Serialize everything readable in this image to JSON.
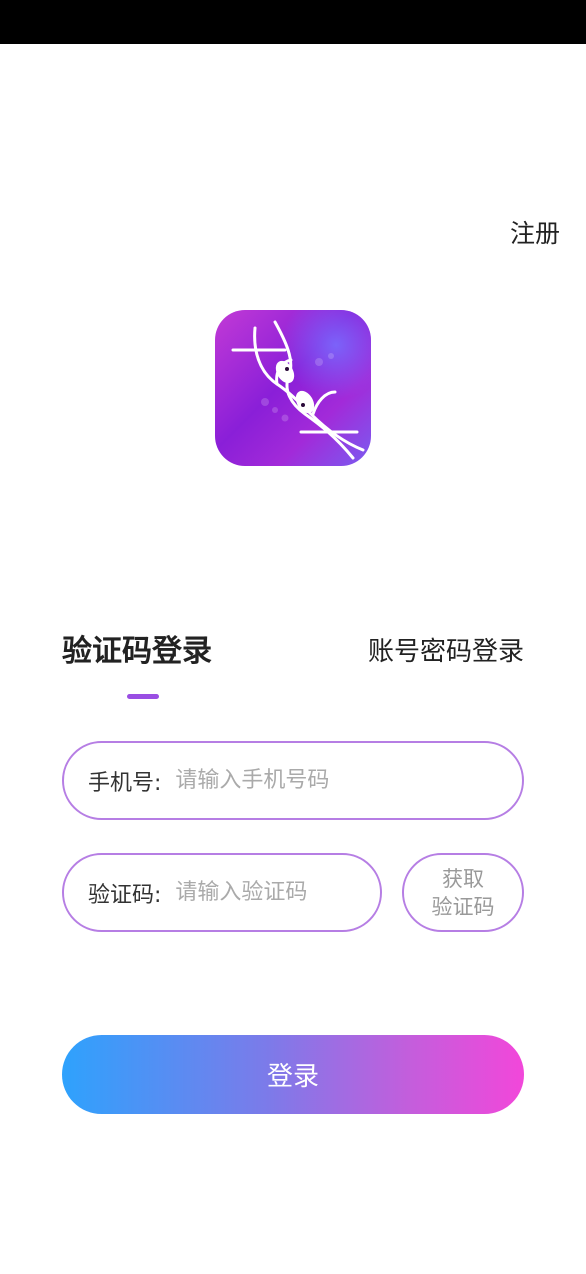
{
  "header": {
    "register_label": "注册"
  },
  "logo": {
    "icon": "dna-fish-logo",
    "gradient": [
      "#c23ad6",
      "#8a1fd8",
      "#7a5cf0"
    ]
  },
  "tabs": {
    "active_label": "验证码登录",
    "inactive_label": "账号密码登录"
  },
  "form": {
    "phone_label": "手机号:",
    "phone_placeholder": "请输入手机号码",
    "code_label": "验证码:",
    "code_placeholder": "请输入验证码",
    "get_code_line1": "获取",
    "get_code_line2": "验证码"
  },
  "login_button": {
    "label": "登录",
    "gradient": [
      "#2ea2fd",
      "#f247da"
    ]
  },
  "colors": {
    "accent": "#9a4ee3",
    "field_border": "#b67ee4",
    "text": "#222222",
    "placeholder": "#aaaaaa"
  }
}
